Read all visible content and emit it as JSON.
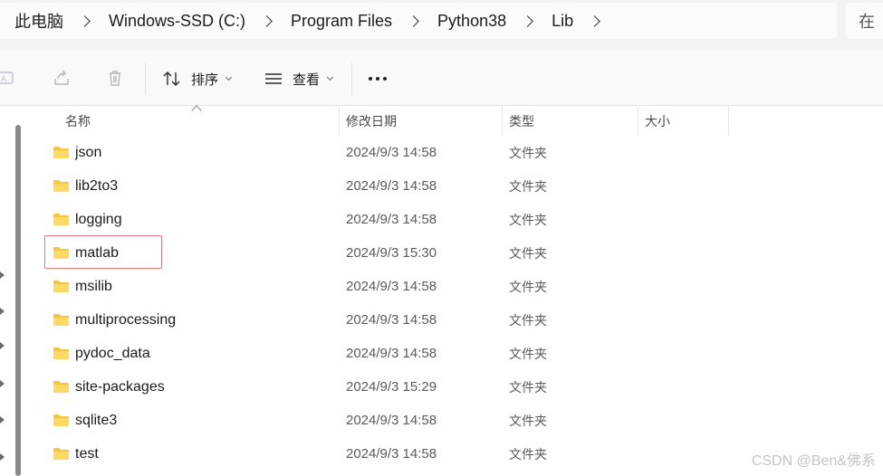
{
  "address_bar": {
    "crumbs": [
      "此电脑",
      "Windows-SSD (C:)",
      "Program Files",
      "Python38",
      "Lib"
    ],
    "search_text": "在"
  },
  "toolbar": {
    "sort_label": "排序",
    "view_label": "查看",
    "icons": [
      "rename-icon",
      "share-icon",
      "delete-icon",
      "sort-icon",
      "view-icon",
      "more-icon"
    ]
  },
  "columns": {
    "name": "名称",
    "date": "修改日期",
    "type": "类型",
    "size": "大小"
  },
  "files": [
    {
      "name": "json",
      "date": "2024/9/3 14:58",
      "type": "文件夹",
      "size": ""
    },
    {
      "name": "lib2to3",
      "date": "2024/9/3 14:58",
      "type": "文件夹",
      "size": ""
    },
    {
      "name": "logging",
      "date": "2024/9/3 14:58",
      "type": "文件夹",
      "size": ""
    },
    {
      "name": "matlab",
      "date": "2024/9/3 15:30",
      "type": "文件夹",
      "size": "",
      "highlighted": true
    },
    {
      "name": "msilib",
      "date": "2024/9/3 14:58",
      "type": "文件夹",
      "size": ""
    },
    {
      "name": "multiprocessing",
      "date": "2024/9/3 14:58",
      "type": "文件夹",
      "size": ""
    },
    {
      "name": "pydoc_data",
      "date": "2024/9/3 14:58",
      "type": "文件夹",
      "size": ""
    },
    {
      "name": "site-packages",
      "date": "2024/9/3 15:29",
      "type": "文件夹",
      "size": ""
    },
    {
      "name": "sqlite3",
      "date": "2024/9/3 14:58",
      "type": "文件夹",
      "size": ""
    },
    {
      "name": "test",
      "date": "2024/9/3 14:58",
      "type": "文件夹",
      "size": ""
    }
  ],
  "highlight_color": "#e07a7a",
  "folder_color": "#f5c542",
  "watermark": "CSDN @Ben&佛系"
}
